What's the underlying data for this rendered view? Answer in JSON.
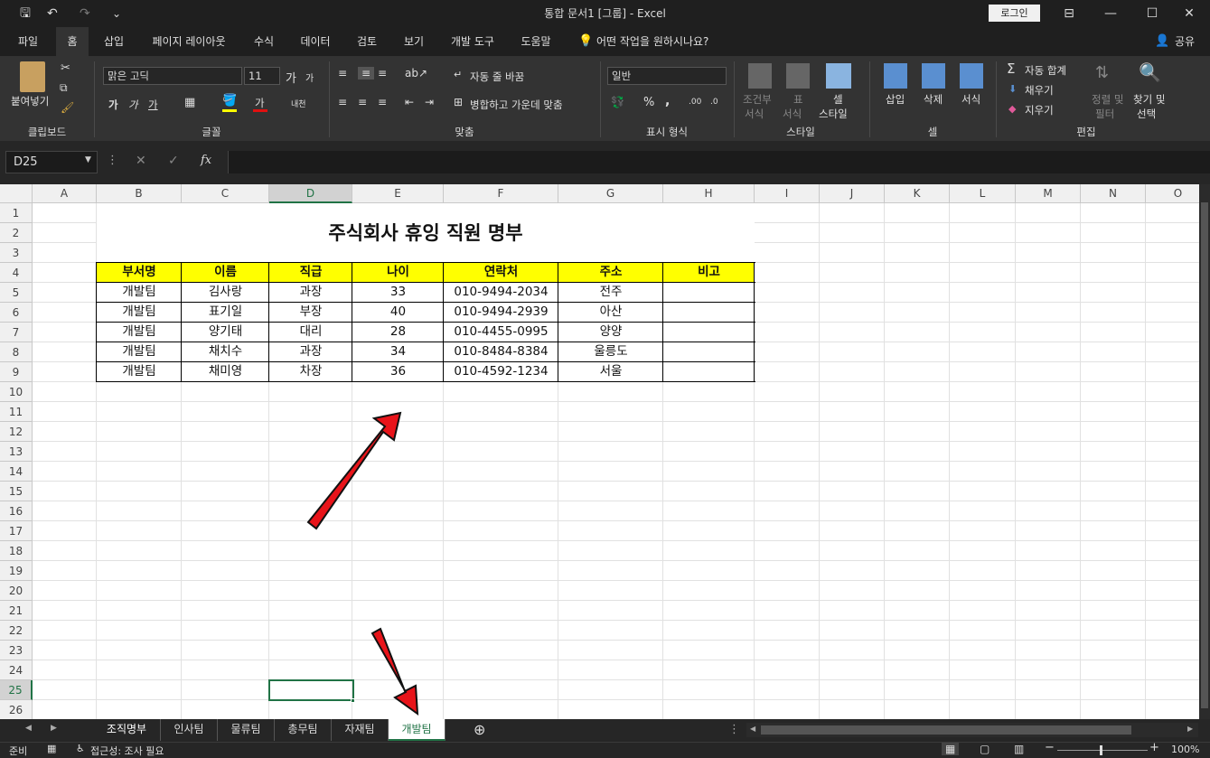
{
  "window": {
    "title": "통합 문서1  [그룹]  -  Excel",
    "login_label": "로그인",
    "minimize": "—",
    "restore": "☐",
    "close": "✕",
    "ribbon_display": "⊟"
  },
  "qat": {
    "save": "🖫",
    "undo": "↶",
    "redo": "↷",
    "customize": "⌄"
  },
  "menu": {
    "tabs": [
      "파일",
      "홈",
      "삽입",
      "페이지 레이아웃",
      "수식",
      "데이터",
      "검토",
      "보기",
      "개발 도구",
      "도움말"
    ],
    "tell_me": "어떤 작업을 원하시나요?",
    "share": "공유"
  },
  "ribbon": {
    "clipboard": {
      "paste": "붙여넣기",
      "group": "클립보드"
    },
    "font": {
      "name": "맑은 고딕",
      "size": "11",
      "grow": "가",
      "shrink": "가",
      "bold": "가",
      "italic": "가",
      "underline": "가",
      "phonetic": "내천",
      "font_color": "가",
      "group": "글꼴"
    },
    "align": {
      "wrap": "자동 줄 바꿈",
      "merge": "병합하고 가운데 맞춤",
      "group": "맞춤"
    },
    "number": {
      "format": "일반",
      "percent": "%",
      "comma": ",",
      "group": "표시 형식"
    },
    "style": {
      "cond1": "조건부",
      "cond2": "서식",
      "table1": "표",
      "table2": "서식",
      "cell1": "셀",
      "cell2": "스타일",
      "group": "스타일"
    },
    "cells": {
      "insert": "삽입",
      "delete": "삭제",
      "format": "서식",
      "group": "셀"
    },
    "edit": {
      "autosum": "자동 합계",
      "fill": "채우기",
      "clear": "지우기",
      "sort1": "정렬 및",
      "sort2": "필터",
      "find1": "찾기 및",
      "find2": "선택",
      "group": "편집"
    }
  },
  "formula_bar": {
    "name_box": "D25",
    "cancel": "✕",
    "enter": "✓",
    "fx": "fx",
    "value": ""
  },
  "columns": [
    "A",
    "B",
    "C",
    "D",
    "E",
    "F",
    "G",
    "H",
    "I",
    "J",
    "K",
    "L",
    "M",
    "N",
    "O"
  ],
  "selected_column": "D",
  "selected_row": 25,
  "rows": [
    1,
    2,
    3,
    4,
    5,
    6,
    7,
    8,
    9,
    10,
    11,
    12,
    13,
    14,
    15,
    16,
    17,
    18,
    19,
    20,
    21,
    22,
    23,
    24,
    25,
    26
  ],
  "sheet": {
    "title": "주식회사 휴잉 직원 명부",
    "headers": [
      "부서명",
      "이름",
      "직급",
      "나이",
      "연락처",
      "주소",
      "비고"
    ],
    "records": [
      [
        "개발팀",
        "김사랑",
        "과장",
        "33",
        "010-9494-2034",
        "전주",
        ""
      ],
      [
        "개발팀",
        "표기일",
        "부장",
        "40",
        "010-9494-2939",
        "아산",
        ""
      ],
      [
        "개발팀",
        "양기태",
        "대리",
        "28",
        "010-4455-0995",
        "양양",
        ""
      ],
      [
        "개발팀",
        "채치수",
        "과장",
        "34",
        "010-8484-8384",
        "울릉도",
        ""
      ],
      [
        "개발팀",
        "채미영",
        "차장",
        "36",
        "010-4592-1234",
        "서울",
        ""
      ]
    ]
  },
  "sheet_tabs": [
    "조직명부",
    "인사팀",
    "물류팀",
    "총무팀",
    "자재팀",
    "개발팀"
  ],
  "active_sheet": "개발팀",
  "add_sheet": "⊕",
  "status": {
    "ready": "준비",
    "accessibility": "접근성: 조사 필요",
    "zoom": "100%"
  },
  "colors": {
    "header_fill": "#ffff00",
    "accent": "#217346",
    "arrow": "#e8141a"
  }
}
